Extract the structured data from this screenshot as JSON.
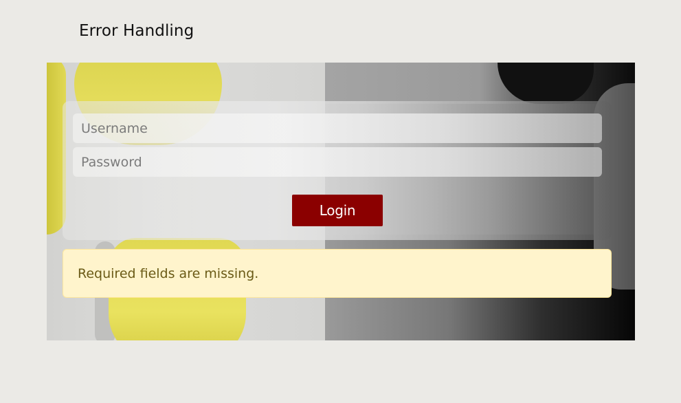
{
  "page": {
    "title": "Error Handling"
  },
  "form": {
    "username": {
      "placeholder": "Username",
      "value": ""
    },
    "password": {
      "placeholder": "Password",
      "value": ""
    },
    "login_label": "Login"
  },
  "alert": {
    "message": "Required fields are missing."
  },
  "colors": {
    "background": "#ebeae6",
    "login_button": "#8b0000",
    "alert_background": "#fff4cc",
    "alert_border": "#ffe79c",
    "alert_text": "#6a5a16"
  }
}
